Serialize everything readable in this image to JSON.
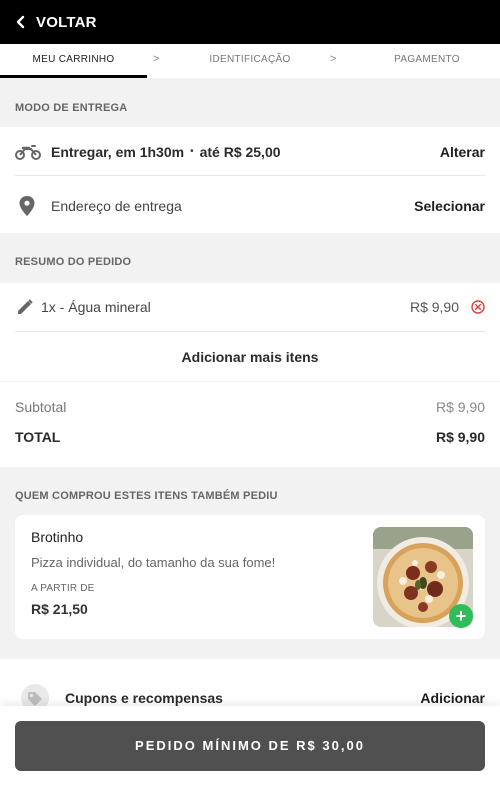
{
  "header": {
    "back_label": "VOLTAR",
    "back_icon": "chevron-left-icon"
  },
  "steps": [
    {
      "label": "MEU CARRINHO",
      "active": true
    },
    {
      "label": "IDENTIFICAÇÃO",
      "active": false
    },
    {
      "label": "PAGAMENTO",
      "active": false
    }
  ],
  "step_separator": ">",
  "delivery": {
    "section_title": "MODO DE ENTREGA",
    "mode_text": "Entregar, em 1h30m",
    "separator": "•",
    "fee_text": "até R$ 25,00",
    "change_label": "Alterar",
    "address_placeholder": "Endereço de entrega",
    "select_label": "Selecionar"
  },
  "order": {
    "section_title": "RESUMO DO PEDIDO",
    "items": [
      {
        "label": "1x - Água mineral",
        "price": "R$ 9,90"
      }
    ],
    "add_more_label": "Adicionar mais itens"
  },
  "summary": {
    "subtotal_label": "Subtotal",
    "subtotal_value": "R$ 9,90",
    "total_label": "TOTAL",
    "total_value": "R$ 9,90"
  },
  "recommendations": {
    "section_title": "QUEM COMPROU ESTES ITENS TAMBÉM PEDIU",
    "items": [
      {
        "name": "Brotinho",
        "description": "Pizza individual, do tamanho da sua fome!",
        "from_label": "A PARTIR DE",
        "price": "R$ 21,50",
        "add_symbol": "+"
      }
    ]
  },
  "coupons": {
    "label": "Cupons e recompensas",
    "action_label": "Adicionar"
  },
  "checkout": {
    "button_label": "PEDIDO MÍNIMO DE R$ 30,00"
  },
  "colors": {
    "topbar": "#000000",
    "add_green": "#2fbd5a",
    "remove_red": "#e23b3b",
    "cta": "#505050"
  }
}
